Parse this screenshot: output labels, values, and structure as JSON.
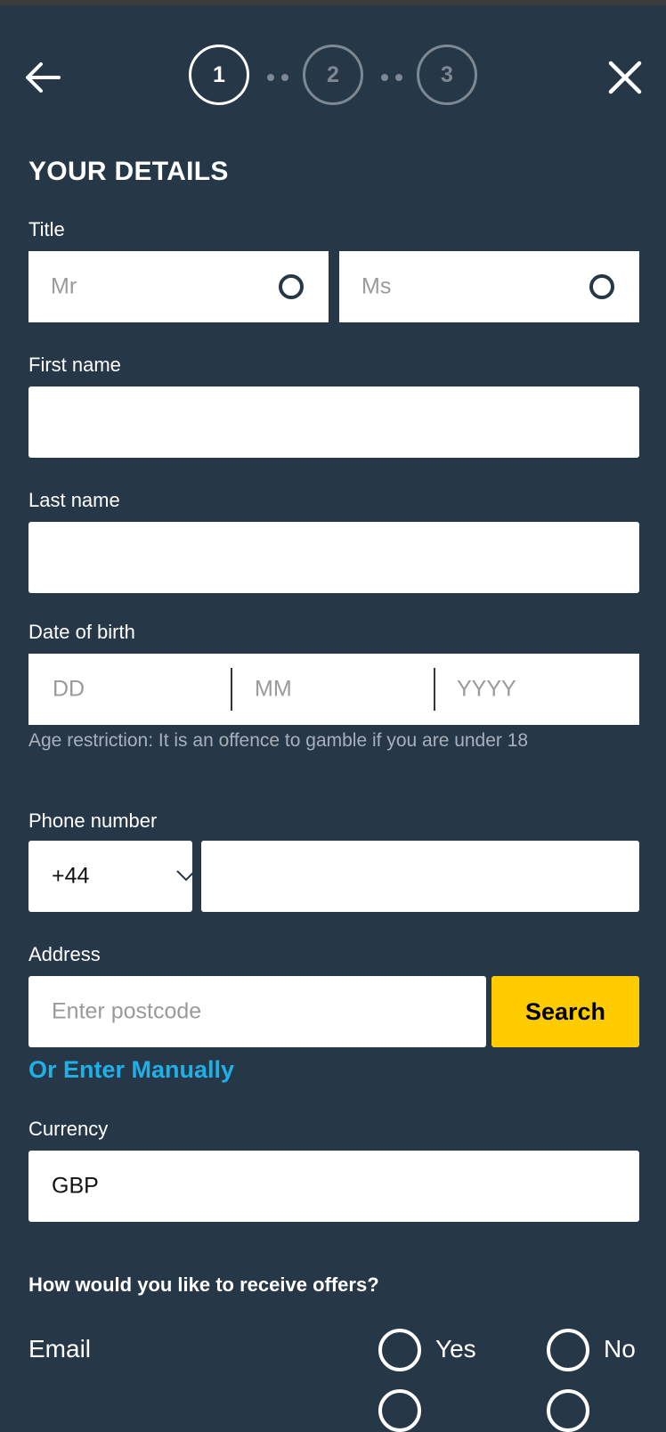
{
  "header": {
    "back_icon": "arrow-left-icon",
    "close_icon": "close-icon",
    "steps": [
      {
        "label": "1",
        "state": "active"
      },
      {
        "label": "2",
        "state": "inactive"
      },
      {
        "label": "3",
        "state": "inactive"
      }
    ]
  },
  "form": {
    "title": "YOUR DETAILS",
    "title_field": {
      "label": "Title",
      "options": [
        {
          "label": "Mr",
          "selected": false
        },
        {
          "label": "Ms",
          "selected": false
        }
      ]
    },
    "first_name": {
      "label": "First name",
      "value": ""
    },
    "last_name": {
      "label": "Last name",
      "value": ""
    },
    "dob": {
      "label": "Date of birth",
      "day_placeholder": "DD",
      "month_placeholder": "MM",
      "year_placeholder": "YYYY",
      "hint": "Age restriction: It is an offence to gamble if you are under 18"
    },
    "phone": {
      "label": "Phone number",
      "country_code": "+44",
      "value": ""
    },
    "address": {
      "label": "Address",
      "placeholder": "Enter postcode",
      "search_label": "Search",
      "manual_link": "Or Enter Manually"
    },
    "currency": {
      "label": "Currency",
      "value": "GBP"
    },
    "offers": {
      "question": "How would you like to receive offers?",
      "channels": [
        {
          "label": "Email",
          "yes_label": "Yes",
          "no_label": "No"
        }
      ]
    }
  },
  "colors": {
    "background": "#263747",
    "accent_button": "#ffcc00",
    "link": "#1fb0e8"
  }
}
